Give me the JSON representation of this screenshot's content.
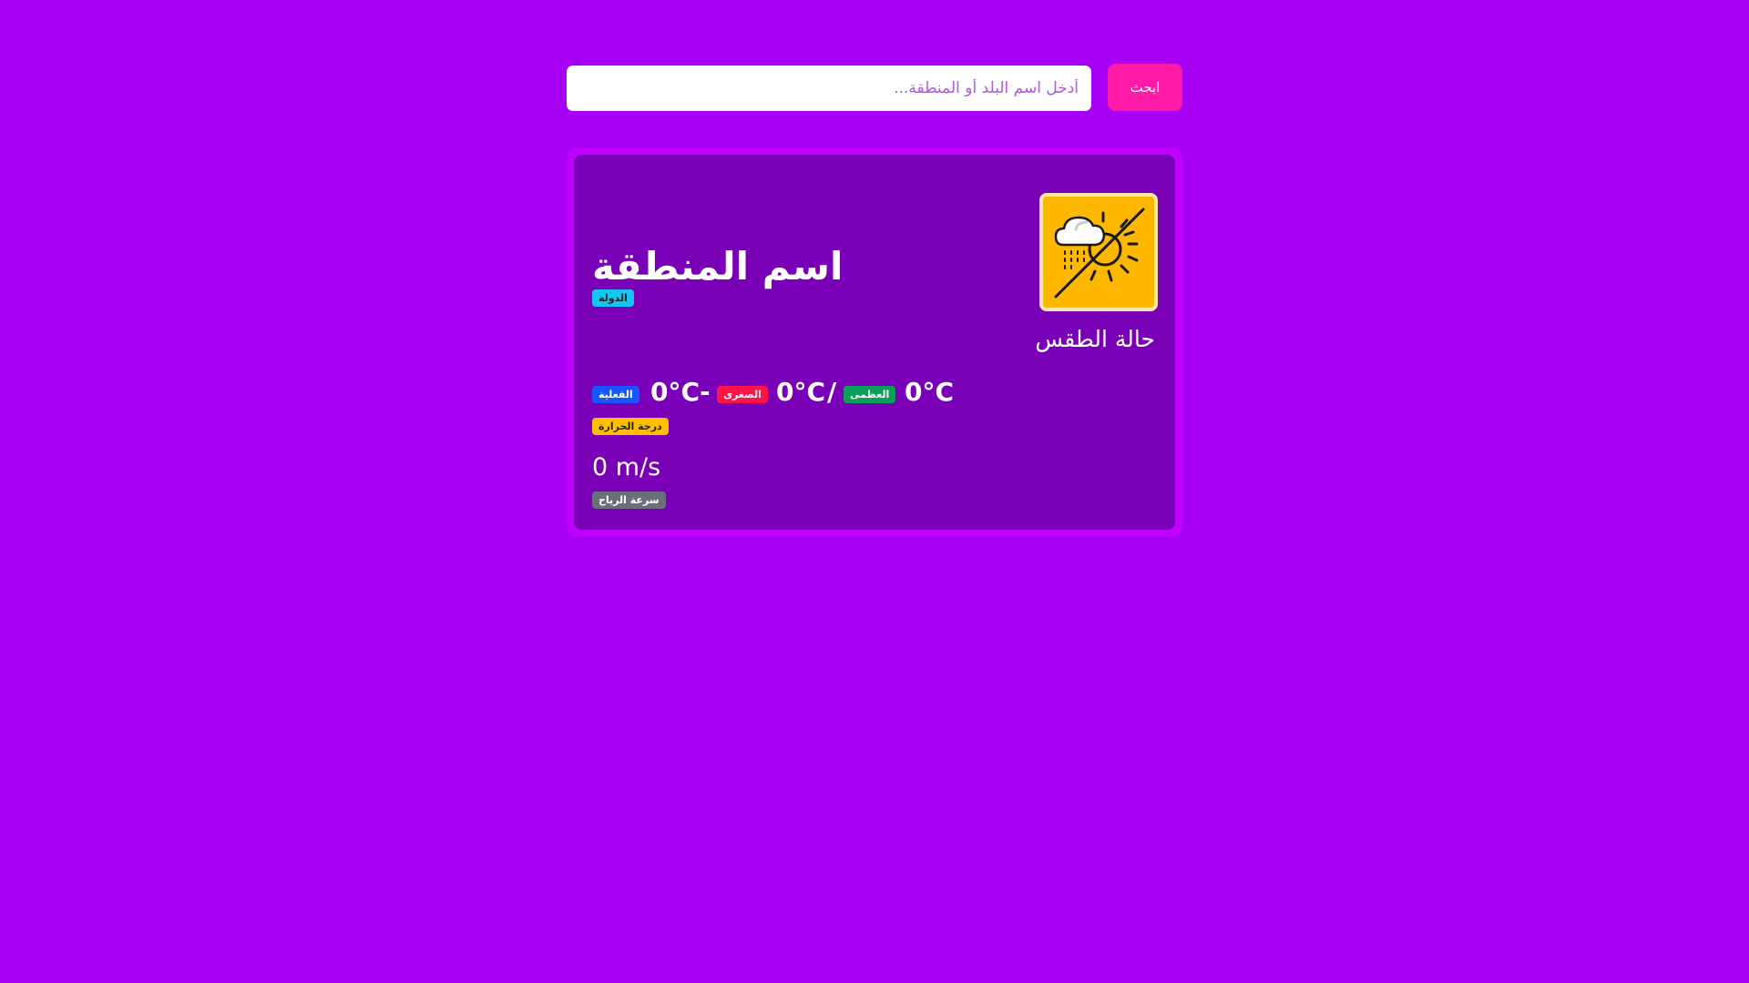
{
  "search": {
    "placeholder": "أدخل اسم البلد أو المنطقة...",
    "value": "",
    "button_label": "ابحث"
  },
  "weather": {
    "region_name": "اسم المنطقة",
    "country_badge": "الدولة",
    "icon": "rain-sun-disabled-icon",
    "description": "حالة الطقس",
    "temperature": {
      "actual_value": "0°C",
      "actual_badge": "الفعلية",
      "separator_dash": "-",
      "min_value": "0°C",
      "min_badge": "الصغرى",
      "separator_slash": "/",
      "max_value": "0°C",
      "max_badge": "العظمى",
      "label_badge": "درجة الحرارة"
    },
    "wind": {
      "value": "0 m/s",
      "label_badge": "سرعة الرياح"
    }
  },
  "colors": {
    "background": "#a800f5",
    "card_border": "#c000ff",
    "card_bg": "#7a00b8",
    "search_button": "#ff1aa8",
    "icon_bg": "#ffb800",
    "badge_country": "#16c5f0",
    "badge_actual": "#1656ff",
    "badge_min": "#ff1448",
    "badge_max": "#0ba05a",
    "badge_temp": "#ffbf00",
    "badge_wind": "#6a707a"
  }
}
